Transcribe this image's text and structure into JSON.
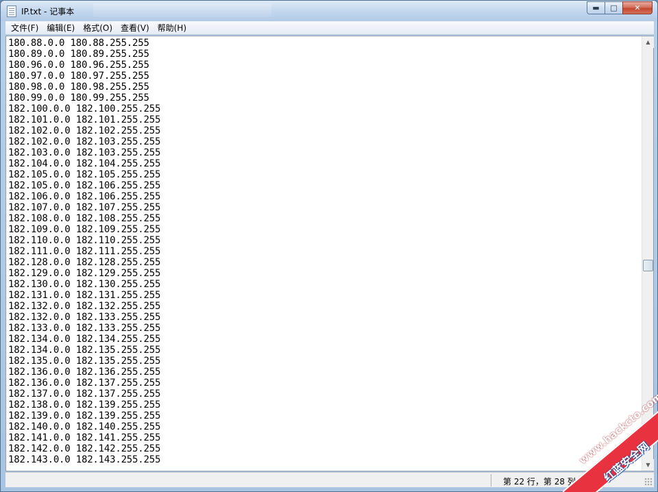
{
  "window": {
    "title": "IP.txt - 记事本",
    "caption_buttons": {
      "minimize": "minimize-icon",
      "maximize": "maximize-icon",
      "close": "close-icon"
    }
  },
  "menu": {
    "items": [
      "文件(F)",
      "编辑(E)",
      "格式(O)",
      "查看(V)",
      "帮助(H)"
    ]
  },
  "editor": {
    "lines": [
      "180.88.0.0 180.88.255.255",
      "180.89.0.0 180.89.255.255",
      "180.96.0.0 180.96.255.255",
      "180.97.0.0 180.97.255.255",
      "180.98.0.0 180.98.255.255",
      "180.99.0.0 180.99.255.255",
      "182.100.0.0 182.100.255.255",
      "182.101.0.0 182.101.255.255",
      "182.102.0.0 182.102.255.255",
      "182.102.0.0 182.103.255.255",
      "182.103.0.0 182.103.255.255",
      "182.104.0.0 182.104.255.255",
      "182.105.0.0 182.105.255.255",
      "182.105.0.0 182.106.255.255",
      "182.106.0.0 182.106.255.255",
      "182.107.0.0 182.107.255.255",
      "182.108.0.0 182.108.255.255",
      "182.109.0.0 182.109.255.255",
      "182.110.0.0 182.110.255.255",
      "182.111.0.0 182.111.255.255",
      "182.128.0.0 182.128.255.255",
      "182.129.0.0 182.129.255.255",
      "182.130.0.0 182.130.255.255",
      "182.131.0.0 182.131.255.255",
      "182.132.0.0 182.132.255.255",
      "182.132.0.0 182.133.255.255",
      "182.133.0.0 182.133.255.255",
      "182.134.0.0 182.134.255.255",
      "182.134.0.0 182.135.255.255",
      "182.135.0.0 182.135.255.255",
      "182.136.0.0 182.136.255.255",
      "182.136.0.0 182.137.255.255",
      "182.137.0.0 182.137.255.255",
      "182.138.0.0 182.139.255.255",
      "182.139.0.0 182.139.255.255",
      "182.140.0.0 182.140.255.255",
      "182.141.0.0 182.141.255.255",
      "182.142.0.0 182.142.255.255",
      "182.143.0.0 182.143.255.255"
    ]
  },
  "scrollbar": {
    "position_fraction": 0.53,
    "up_icon": "scroll-up-icon",
    "down_icon": "scroll-down-icon"
  },
  "status": {
    "cursor_position": "第 22 行，第 28 列"
  },
  "watermark": {
    "url": "www.hackcto.com",
    "name": "红蓝安全网",
    "color": "#e8323f"
  }
}
